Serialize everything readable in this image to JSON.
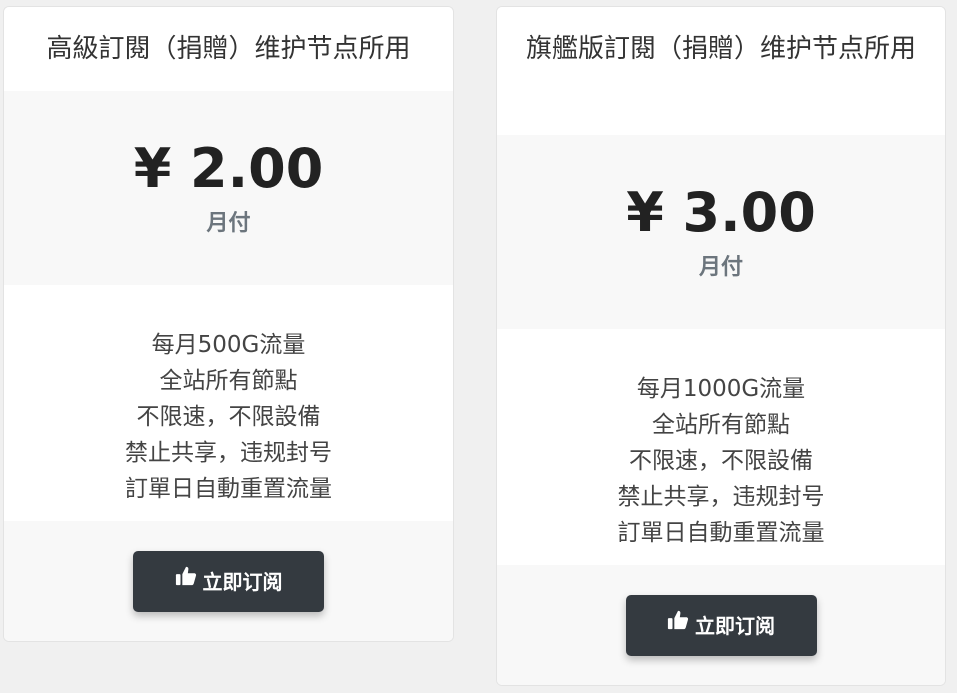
{
  "plans": [
    {
      "title": "高級訂閱（捐贈）维护节点所用",
      "price": "¥ 2.00",
      "period": "月付",
      "features": [
        "每月500G流量",
        "全站所有節點",
        "不限速，不限設備",
        "禁止共享，违规封号",
        "訂單日自動重置流量"
      ],
      "button_label": "立即订阅",
      "button_icon": "thumbs-up-icon"
    },
    {
      "title": "旗艦版訂閱（捐贈）维护节点所用",
      "price": "¥ 3.00",
      "period": "月付",
      "features": [
        "每月1000G流量",
        "全站所有節點",
        "不限速，不限設備",
        "禁止共享，违规封号",
        "訂單日自動重置流量"
      ],
      "button_label": "立即订阅",
      "button_icon": "thumbs-up-icon"
    }
  ],
  "colors": {
    "button_bg": "#343a40",
    "price_text": "#222222",
    "period_text": "#6c757d",
    "section_bg": "#f8f8f8"
  }
}
